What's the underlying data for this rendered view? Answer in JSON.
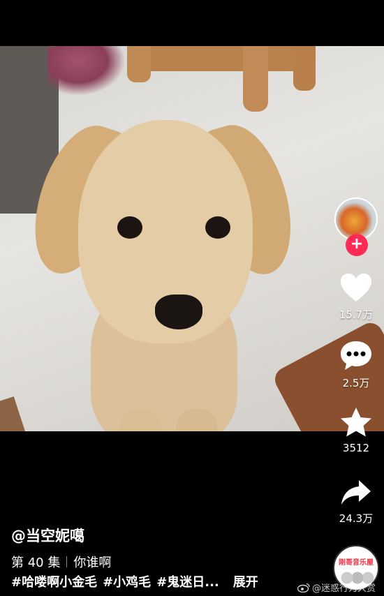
{
  "video": {
    "subject": "golden retriever puppy"
  },
  "creator": {
    "follow_label": "+"
  },
  "actions": {
    "like_count": "15.7万",
    "comment_count": "2.5万",
    "favorite_count": "3512",
    "share_count": "24.3万"
  },
  "info": {
    "author": "@当空妮噶",
    "episode": "第 40 集",
    "episode_title": "你谁啊",
    "tags": [
      "#哈喽啊小金毛",
      "#小鸡毛",
      "#鬼迷日..."
    ],
    "expand_label": "展开"
  },
  "music": {
    "disc_label": "刚哥音乐屋"
  },
  "watermark": {
    "text": "@迷惑行为大赏"
  },
  "colors": {
    "follow_red": "#fe2c55",
    "background": "#000000",
    "text": "#ffffff"
  }
}
